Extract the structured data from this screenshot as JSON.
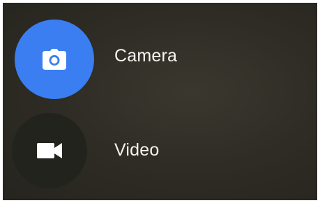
{
  "modes": [
    {
      "label": "Camera",
      "icon": "camera-icon",
      "selected": true,
      "circle_color": "#3a7ef2",
      "icon_color": "#ffffff"
    },
    {
      "label": "Video",
      "icon": "videocam-icon",
      "selected": false,
      "circle_color": "#23231d",
      "icon_color": "#ffffff"
    }
  ],
  "colors": {
    "background": "#2f2d25",
    "label_text": "#f4f4f0"
  }
}
